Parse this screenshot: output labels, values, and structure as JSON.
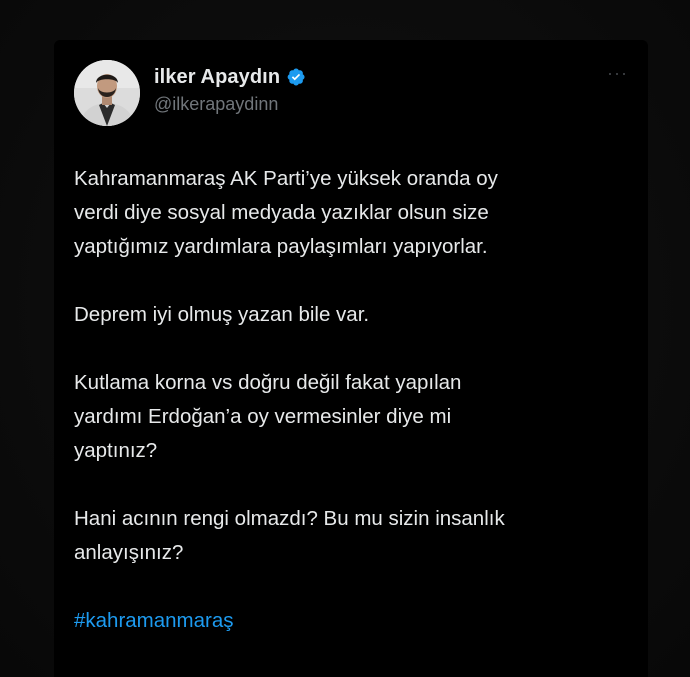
{
  "author": {
    "display_name": "ilker Apaydın",
    "handle": "@ilkerapaydinn",
    "verified": true,
    "avatar_icon": "profile-photo",
    "verified_icon": "verified-badge-icon",
    "verified_color": "#1d9bf0"
  },
  "more_label": "···",
  "tweet": {
    "paragraphs": [
      "Kahramanmaraş AK Parti’ye yüksek oranda oy\nverdi diye sosyal medyada yazıklar olsun size\nyaptığımız yardımlara paylaşımları yapıyorlar.",
      "Deprem iyi olmuş yazan bile var.",
      "Kutlama korna vs doğru değil fakat yapılan\nyardımı Erdoğan’a oy vermesinler diye mi\nyaptınız?",
      "Hani acının rengi olmazdı? Bu mu sizin insanlık\nanlayışınız?"
    ],
    "hashtag": "#kahramanmaraş"
  },
  "colors": {
    "background": "#000000",
    "text": "#e7e9ea",
    "secondary_text": "#71767b",
    "link": "#1d9bf0"
  }
}
